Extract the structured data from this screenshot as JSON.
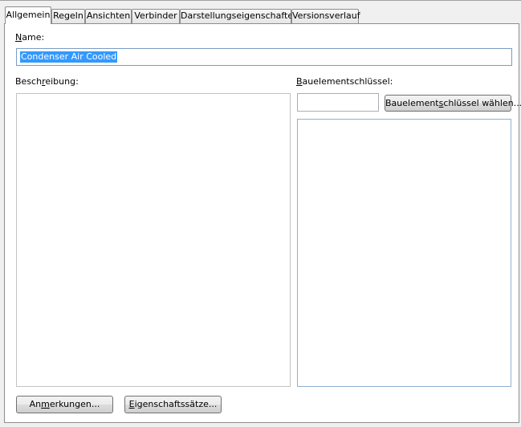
{
  "tabs": [
    {
      "label": "Allgemein",
      "active": true
    },
    {
      "label": "Regeln",
      "active": false
    },
    {
      "label": "Ansichten",
      "active": false
    },
    {
      "label": "Verbinder",
      "active": false
    },
    {
      "label": "Darstellungseigenschaften",
      "active": false
    },
    {
      "label": "Versionsverlauf",
      "active": false
    }
  ],
  "name": {
    "label_pre": "",
    "label_key": "N",
    "label_post": "ame:",
    "value": "Condenser Air Cooled"
  },
  "description": {
    "label_pre": "Besch",
    "label_key": "r",
    "label_post": "eibung:",
    "value": ""
  },
  "component_key": {
    "label_pre": "",
    "label_key": "B",
    "label_post": "auelementschlüssel:",
    "value": "",
    "button_pre": "Bauelement",
    "button_key": "s",
    "button_post": "chlüssel wählen...",
    "list_value": ""
  },
  "buttons": {
    "notes_pre": "An",
    "notes_key": "m",
    "notes_post": "erkungen...",
    "propsets_pre": "",
    "propsets_key": "E",
    "propsets_post": "igenschaftssätze..."
  },
  "colors": {
    "selection": "#3399ff",
    "focus_border": "#7a9cc4",
    "panel_border": "#8d8d8d"
  }
}
